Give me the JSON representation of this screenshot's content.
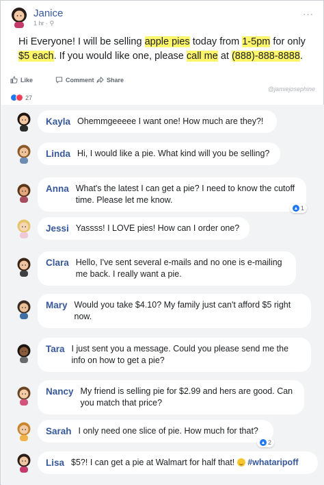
{
  "post": {
    "author": "Janice",
    "meta": "1 hr · ",
    "more": "···",
    "text": [
      {
        "t": "Hi Everyone! I will be selling ",
        "hl": false
      },
      {
        "t": "apple pies",
        "hl": true
      },
      {
        "t": " today from ",
        "hl": false
      },
      {
        "t": "1-5pm",
        "hl": true
      },
      {
        "t": " for only ",
        "hl": false
      },
      {
        "t": "$5 each",
        "hl": true
      },
      {
        "t": ". If you would like one, please ",
        "hl": false
      },
      {
        "t": "call me",
        "hl": true
      },
      {
        "t": " at ",
        "hl": false
      },
      {
        "t": "(888)-888-8888",
        "hl": true
      },
      {
        "t": ".",
        "hl": false
      }
    ]
  },
  "actions": {
    "like": "Like",
    "comment": "Comment",
    "share": "Share"
  },
  "watermark": "@jamiejosephine",
  "reactions": {
    "count": "27"
  },
  "comments": [
    {
      "name": "Kayla",
      "text": "Ohemmgeeeee I want one! How much are they?!"
    },
    {
      "name": "Linda",
      "text": "Hi, I would like a pie. What kind will you be selling?"
    },
    {
      "name": "Anna",
      "text": "What's the latest I can get a pie? I need to know the cutoff time. Please let me know.",
      "likes": "1"
    },
    {
      "name": "Jessi",
      "text": "Yassss! I LOVE pies! How can I order one?"
    },
    {
      "name": "Clara",
      "text": "Hello, I've sent several e-mails and no one is e-mailing me back. I really want a pie."
    },
    {
      "name": "Mary",
      "text": "Would you take $4.10? My family just can't afford $5 right now."
    },
    {
      "name": "Tara",
      "text": "I just sent you a message. Could you please send me the info on how to get a pie?"
    },
    {
      "name": "Nancy",
      "text": "My friend is selling pie for $2.99 and hers are good. Can you match that price?"
    },
    {
      "name": "Sarah",
      "text": "I only need one slice of pie. How much for that?",
      "likes": "2"
    },
    {
      "name": "Lisa",
      "text": "$5?! I can get a pie at Walmart for half that! ",
      "hashtag": "#whataripoff"
    }
  ]
}
